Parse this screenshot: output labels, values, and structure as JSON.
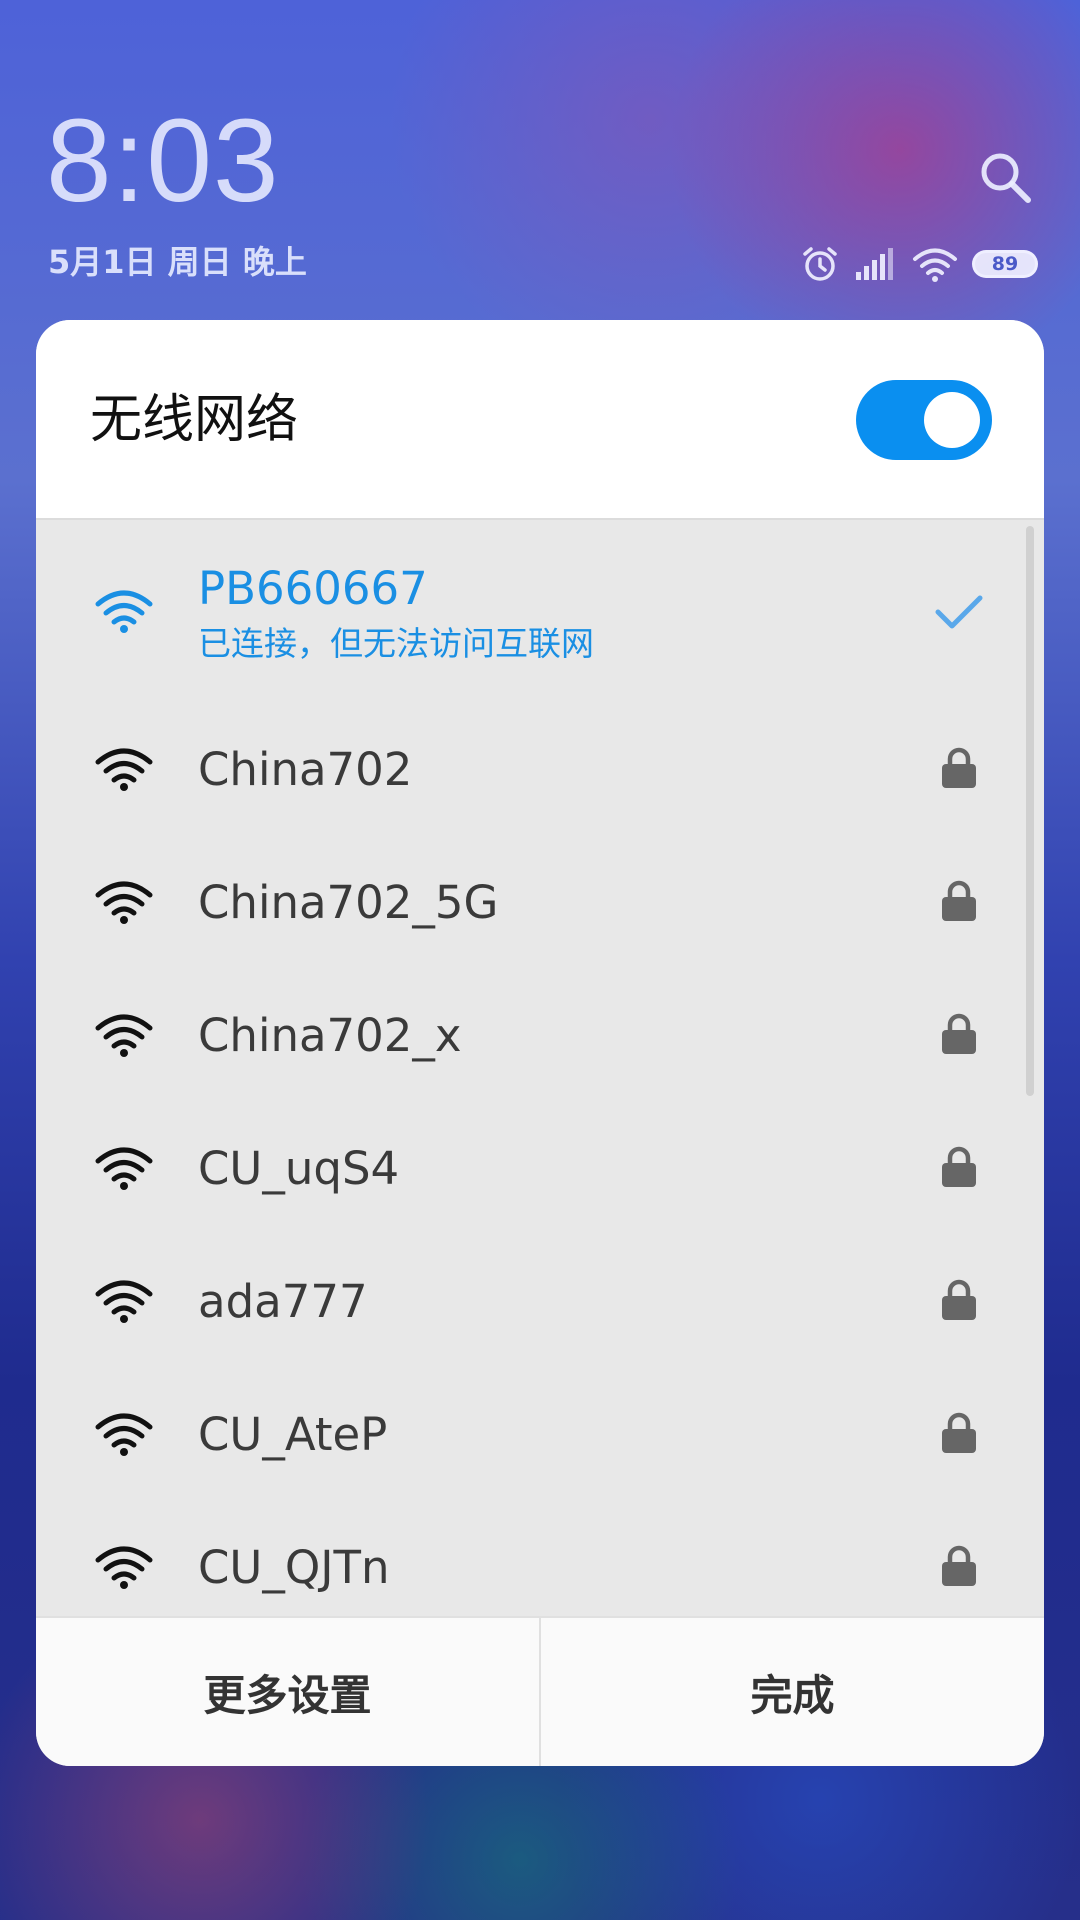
{
  "status": {
    "time": "8:03",
    "date": "5月1日 周日 晚上",
    "battery": "89"
  },
  "dialog": {
    "title": "无线网络",
    "wifi_enabled": true,
    "connected": {
      "ssid": "PB660667",
      "status": "已连接，但无法访问互联网"
    },
    "networks": [
      {
        "ssid": "China702"
      },
      {
        "ssid": "China702_5G"
      },
      {
        "ssid": "China702_x"
      },
      {
        "ssid": "CU_uqS4"
      },
      {
        "ssid": "ada777"
      },
      {
        "ssid": "CU_AteP"
      },
      {
        "ssid": "CU_QJTn"
      }
    ],
    "more_settings_label": "更多设置",
    "done_label": "完成"
  },
  "colors": {
    "accent": "#0a8ff0",
    "connected_text": "#1a8fe3",
    "dialog_bg": "#e8e8e8"
  },
  "icons": [
    "search-icon",
    "alarm-icon",
    "cell-signal-icon",
    "wifi-status-icon",
    "wifi-signal-icon",
    "lock-icon",
    "check-icon"
  ]
}
